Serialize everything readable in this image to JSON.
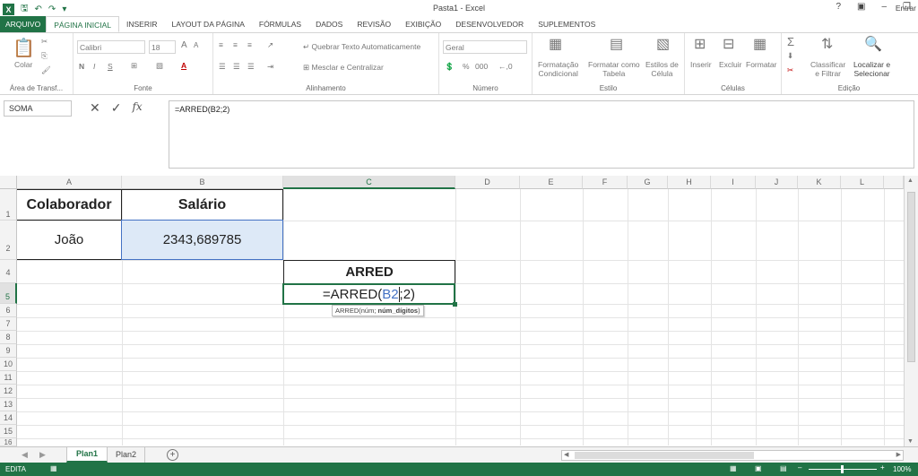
{
  "window": {
    "title": "Pasta1 - Excel",
    "help": "?",
    "user": "Entrar"
  },
  "tabs": [
    "ARQUIVO",
    "PÁGINA INICIAL",
    "INSERIR",
    "LAYOUT DA PÁGINA",
    "FÓRMULAS",
    "DADOS",
    "REVISÃO",
    "EXIBIÇÃO",
    "DESENVOLVEDOR",
    "SUPLEMENTOS"
  ],
  "ribbon": {
    "clipboard": {
      "paste": "Colar",
      "label": "Área de Transf..."
    },
    "font": {
      "name": "Calibri",
      "size": "18",
      "bold": "N",
      "italic": "I",
      "underline": "S",
      "grow": "A",
      "shrink": "A",
      "label": "Fonte"
    },
    "alignment": {
      "wrap": "Quebrar Texto Automaticamente",
      "merge": "Mesclar e Centralizar",
      "label": "Alinhamento"
    },
    "number": {
      "format": "Geral",
      "percent": "%",
      "thousands": "000",
      "label": "Número"
    },
    "styles": {
      "conditional_1": "Formatação",
      "conditional_2": "Condicional",
      "as_table_1": "Formatar como",
      "as_table_2": "Tabela",
      "cell_styles_1": "Estilos de",
      "cell_styles_2": "Célula",
      "label": "Estilo"
    },
    "cells": {
      "insert": "Inserir",
      "delete": "Excluir",
      "format": "Formatar",
      "label": "Células"
    },
    "editing": {
      "sort_1": "Classificar",
      "sort_2": "e Filtrar",
      "find_1": "Localizar e",
      "find_2": "Selecionar",
      "label": "Edição"
    }
  },
  "formula_bar": {
    "name_box": "SOMA",
    "cancel": "✕",
    "enter": "✓",
    "fx": "fx",
    "formula": "=ARRED(B2;2)"
  },
  "columns": [
    "A",
    "B",
    "C",
    "D",
    "E",
    "F",
    "G",
    "H",
    "I",
    "J",
    "K",
    "L"
  ],
  "rows": [
    "1",
    "2",
    "4",
    "5",
    "6",
    "7",
    "8",
    "9",
    "10",
    "11",
    "12",
    "13",
    "14",
    "15",
    "16"
  ],
  "cells": {
    "a1": "Colaborador",
    "b1": "Salário",
    "a2": "João",
    "b2": "2343,689785",
    "c4": "ARRED",
    "c5_prefix": "=ARRED(",
    "c5_ref": "B2",
    "c5_suffix": ";2)"
  },
  "tooltip": {
    "prefix": "ARRED(núm; ",
    "bold": "núm_dígitos",
    "suffix": ")"
  },
  "sheets": [
    "Plan1",
    "Plan2"
  ],
  "status": {
    "mode": "EDITA",
    "zoom": "100%"
  },
  "colors": {
    "accent": "#217346",
    "ref": "#4472c4"
  }
}
